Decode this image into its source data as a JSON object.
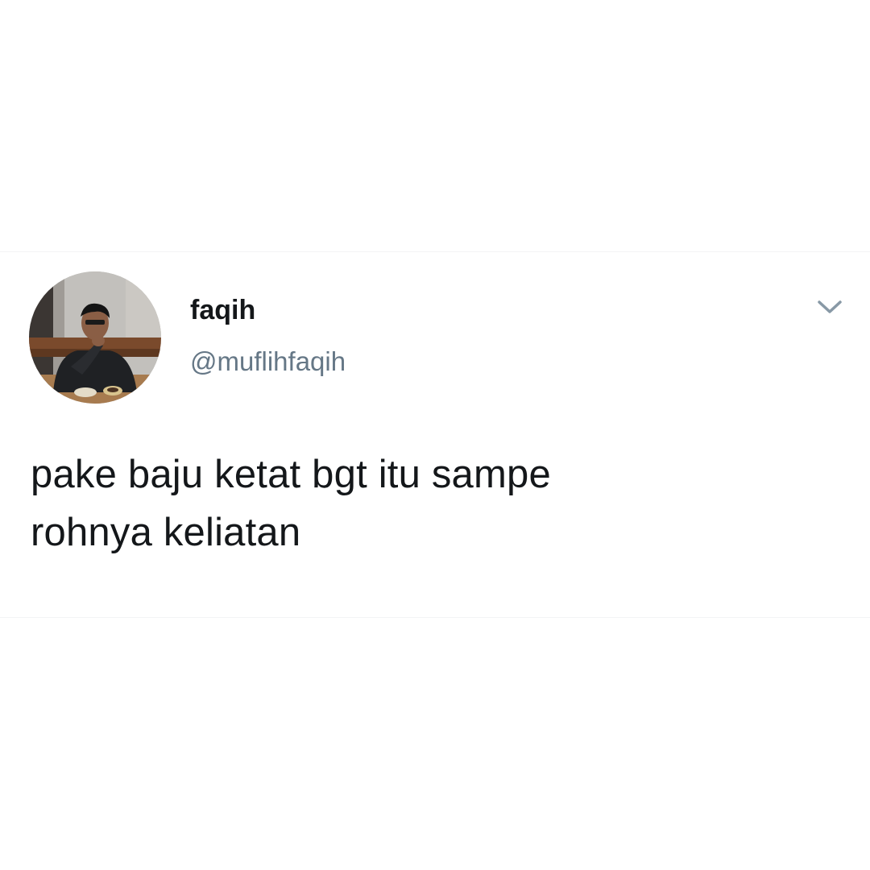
{
  "tweet": {
    "author": {
      "display_name": "faqih",
      "handle": "@muflihfaqih",
      "avatar_icon": "profile-photo"
    },
    "menu_icon": "chevron-down-icon",
    "text_lines": [
      "pake baju ketat bgt itu sampe",
      "rohnya keliatan"
    ]
  },
  "colors": {
    "background": "#ffffff",
    "text_primary": "#14171a",
    "text_secondary": "#657786",
    "chevron": "#8899a6"
  }
}
